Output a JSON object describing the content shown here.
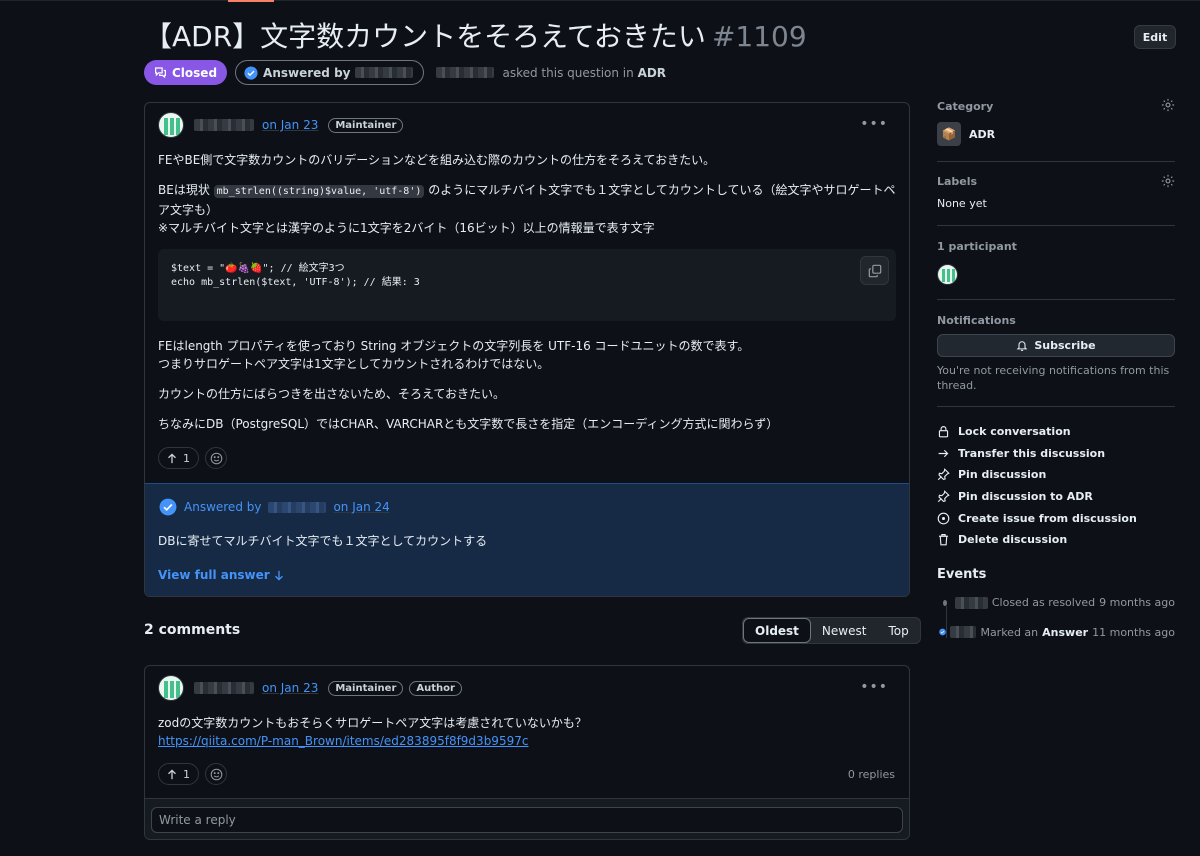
{
  "header": {
    "title": "【ADR】文字数カウントをそろえておきたい",
    "number": "#1109",
    "edit_label": "Edit"
  },
  "meta": {
    "status": "Closed",
    "answered_by": "Answered by",
    "asked_text": "asked this question in",
    "category_link": "ADR"
  },
  "post": {
    "date": "on Jan 23",
    "role": "Maintainer",
    "p1": "FEやBE側で文字数カウントのバリデーションなどを組み込む際のカウントの仕方をそろえておきたい。",
    "p2_pre": "BEは現状",
    "p2_code": "mb_strlen((string)$value, 'utf-8')",
    "p2_post": "のようにマルチバイト文字でも１文字としてカウントしている（絵文字やサロゲートペ",
    "p2_line2": "ア文字も）",
    "p2_line3": "※マルチバイト文字とは漢字のように1文字を2バイト（16ビット）以上の情報量で表す文字",
    "code_line1": "$text = \"🍅🍇🍓\"; // 絵文字3つ",
    "code_line2": "echo mb_strlen($text, 'UTF-8'); // 結果: 3",
    "p3_line1": "FEはlength プロパティを使っており String オブジェクトの文字列長を UTF-16 コードユニットの数で表す。",
    "p3_line2": "つまりサロゲートペア文字は1文字としてカウントされるわけではない。",
    "p4": "カウントの仕方にばらつきを出さないため、そろえておきたい。",
    "p5": "ちなみにDB（PostgreSQL）ではCHAR、VARCHARとも文字数で長さを指定（エンコーディング方式に関わらず）",
    "upvotes": "1"
  },
  "answer": {
    "prefix": "Answered by",
    "date": "on Jan 24",
    "text": "DBに寄せてマルチバイト文字でも１文字としてカウントする",
    "view_full": "View full answer"
  },
  "comments": {
    "title": "2 comments",
    "sort": [
      "Oldest",
      "Newest",
      "Top"
    ],
    "sort_active": "Oldest",
    "items": [
      {
        "date": "on Jan 23",
        "roles": [
          "Maintainer",
          "Author"
        ],
        "text": "zodの文字数カウントもおそらくサロゲートペア文字は考慮されていないかも？",
        "link": "https://qiita.com/P-man_Brown/items/ed283895f8f9d3b9597c",
        "upvotes": "1",
        "replies": "0 replies"
      }
    ],
    "reply_placeholder": "Write a reply"
  },
  "sidebar": {
    "category_h": "Category",
    "category_value": "ADR",
    "labels_h": "Labels",
    "labels_value": "None yet",
    "participants_h": "1 participant",
    "notifications_h": "Notifications",
    "subscribe": "Subscribe",
    "notif_note": "You're not receiving notifications from this thread.",
    "actions": [
      {
        "label": "Lock conversation",
        "icon": "lock-icon"
      },
      {
        "label": "Transfer this discussion",
        "icon": "arrow-right-icon"
      },
      {
        "label": "Pin discussion",
        "icon": "pin-icon"
      },
      {
        "label": "Pin discussion to ADR",
        "icon": "pin-icon"
      },
      {
        "label": "Create issue from discussion",
        "icon": "issue-opened-icon"
      },
      {
        "label": "Delete discussion",
        "icon": "trash-icon"
      }
    ],
    "events_h": "Events",
    "events": [
      {
        "text": "Closed as resolved",
        "time": "9 months ago"
      },
      {
        "text_pre": "Marked an",
        "text_bold": "Answer",
        "time": "11 months ago"
      }
    ]
  },
  "colors": {
    "closed_badge": "#8957e5",
    "link": "#4493f8",
    "answer_bg": "#172a45",
    "page_bg": "#0d1117"
  }
}
